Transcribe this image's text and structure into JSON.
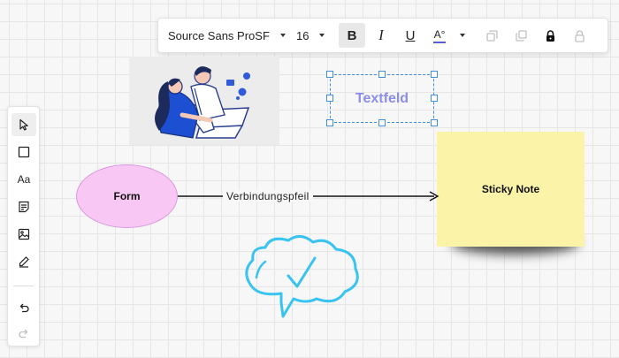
{
  "toolbar": {
    "font_family": "Source Sans ProSF",
    "font_size": "16",
    "bold_glyph": "B",
    "italic_glyph": "I",
    "underline_glyph": "U",
    "text_color_glyph": "A°",
    "text_color": "#5b5bd6"
  },
  "palette": {
    "text_tool_label": "Aa"
  },
  "canvas": {
    "textfield_label": "Textfeld",
    "form_label": "Form",
    "connector_label": "Verbindungspfeil",
    "sticky_label": "Sticky Note"
  },
  "colors": {
    "form_fill": "#f8c7f3",
    "sticky_fill": "#faf3a8",
    "selection": "#3f8fe0",
    "doodle": "#39c3f0"
  }
}
